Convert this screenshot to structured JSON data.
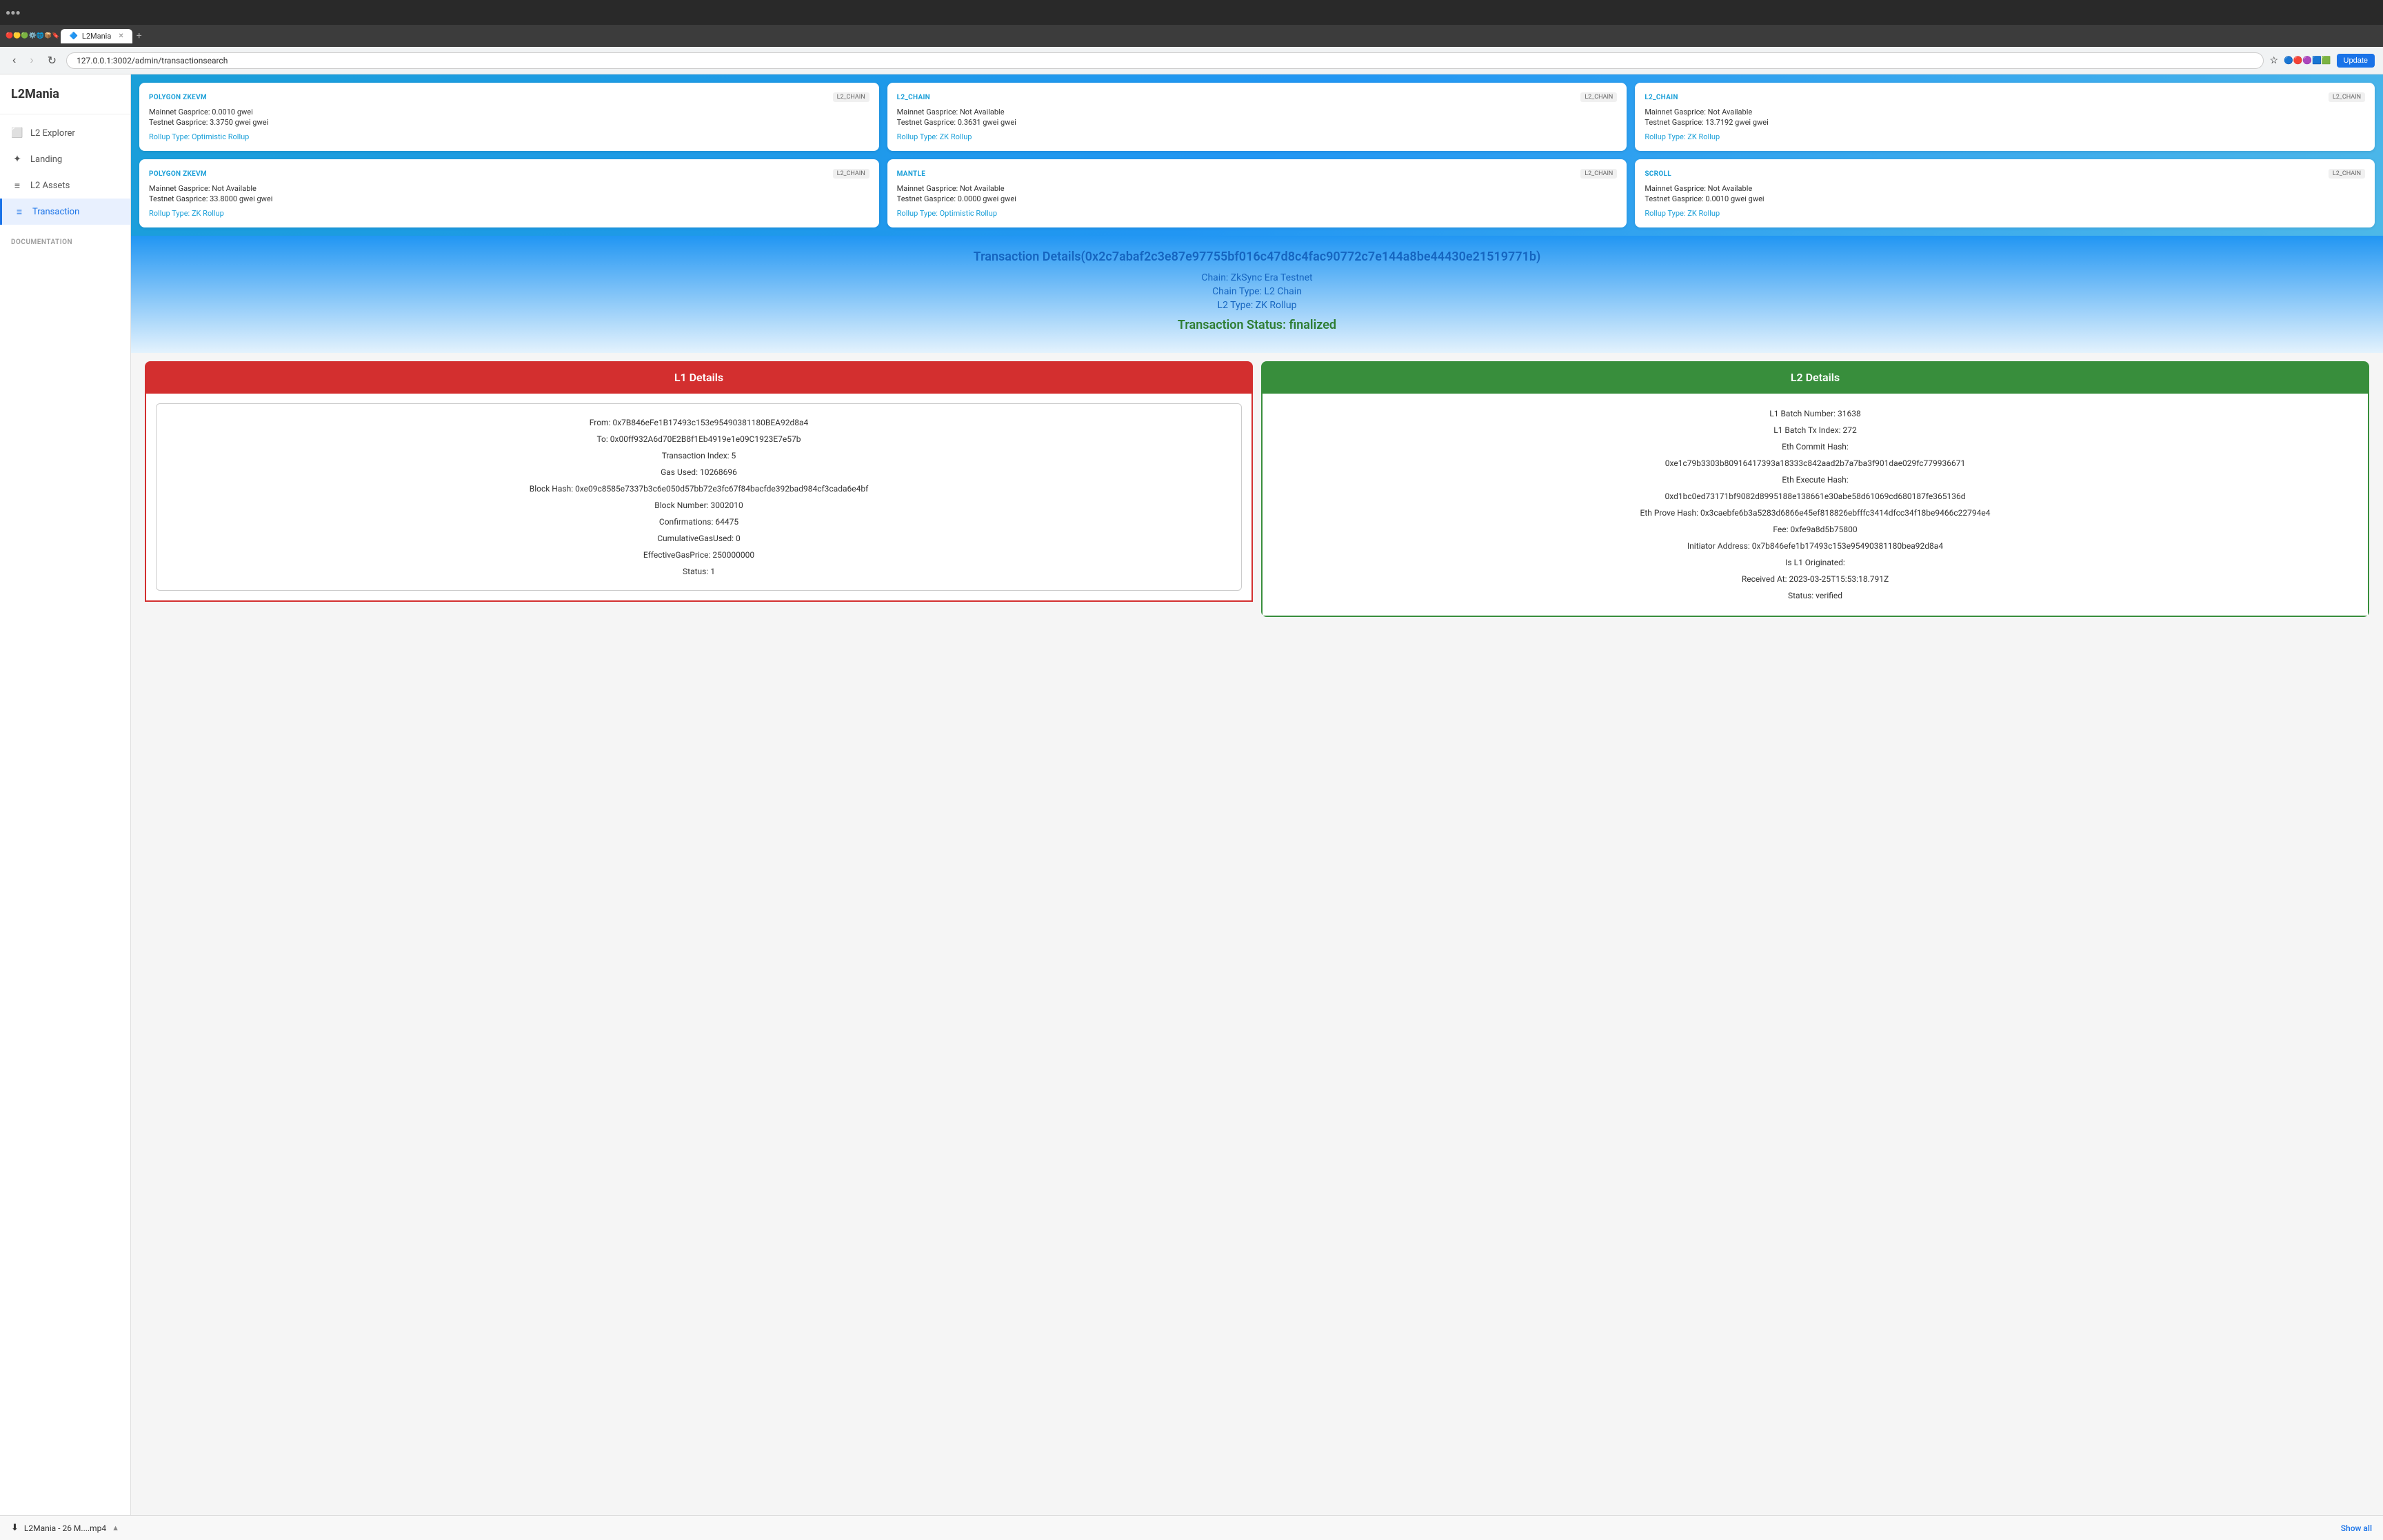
{
  "browser": {
    "url": "127.0.0.1:3002/admin/transactionsearch",
    "tab_title": "L2Mania",
    "update_btn": "Update"
  },
  "sidebar": {
    "logo": "L2Mania",
    "items": [
      {
        "id": "l2-explorer",
        "label": "L2 Explorer",
        "icon": "⬜"
      },
      {
        "id": "landing",
        "label": "Landing",
        "icon": "✦"
      },
      {
        "id": "l2-assets",
        "label": "L2 Assets",
        "icon": "≡"
      },
      {
        "id": "transaction",
        "label": "Transaction",
        "icon": "≡",
        "active": true
      }
    ],
    "section_documentation": "DOCUMENTATION"
  },
  "chain_cards": [
    {
      "name": "POLYGON ZKEVM",
      "badge": "L2_CHAIN",
      "mainnet_gasprice": "Mainnet Gasprice: 0.0010 gwei",
      "testnet_gasprice": "Testnet Gasprice: 3.3750 gwei gwei",
      "rollup_type": "Rollup Type: Optimistic Rollup"
    },
    {
      "name": "L2_CHAIN",
      "badge": "L2_CHAIN",
      "mainnet_gasprice": "Mainnet Gasprice: Not Available",
      "testnet_gasprice": "Testnet Gasprice: 0.3631 gwei gwei",
      "rollup_type": "Rollup Type: ZK Rollup"
    },
    {
      "name": "L2_CHAIN",
      "badge": "L2_CHAIN",
      "mainnet_gasprice": "Mainnet Gasprice: Not Available",
      "testnet_gasprice": "Testnet Gasprice: 13.7192 gwei gwei",
      "rollup_type": "Rollup Type: ZK Rollup"
    },
    {
      "name": "POLYGON ZKEVM",
      "badge": "L2_CHAIN",
      "mainnet_gasprice": "Mainnet Gasprice: Not Available",
      "testnet_gasprice": "Testnet Gasprice: 33.8000 gwei gwei",
      "rollup_type": "Rollup Type: ZK Rollup"
    },
    {
      "name": "MANTLE",
      "badge": "L2_CHAIN",
      "mainnet_gasprice": "Mainnet Gasprice: Not Available",
      "testnet_gasprice": "Testnet Gasprice: 0.0000 gwei gwei",
      "rollup_type": "Rollup Type: Optimistic Rollup"
    },
    {
      "name": "SCROLL",
      "badge": "L2_CHAIN",
      "mainnet_gasprice": "Mainnet Gasprice: Not Available",
      "testnet_gasprice": "Testnet Gasprice: 0.0010 gwei gwei",
      "rollup_type": "Rollup Type: ZK Rollup"
    }
  ],
  "transaction": {
    "title": "Transaction Details(0x2c7abaf2c3e87e97755bf016c47d8c4fac90772c7e144a8be44430e21519771b)",
    "chain": "Chain: ZkSync Era Testnet",
    "chain_type": "Chain Type: L2 Chain",
    "l2_type": "L2 Type: ZK Rollup",
    "status": "Transaction Status: finalized"
  },
  "l1_details": {
    "header": "L1 Details",
    "from": "From: 0x7B846eFe1B17493c153e95490381180BEA92d8a4",
    "to": "To: 0x00ff932A6d70E2B8f1Eb4919e1e09C1923E7e57b",
    "transaction_index": "Transaction Index: 5",
    "gas_used": "Gas Used: 10268696",
    "block_hash": "Block Hash: 0xe09c8585e7337b3c6e050d57bb72e3fc67f84bacfde392bad984cf3cada6e4bf",
    "block_number": "Block Number: 3002010",
    "confirmations": "Confirmations: 64475",
    "cumulative_gas": "CumulativeGasUsed: 0",
    "effective_gas": "EffectiveGasPrice: 250000000",
    "status": "Status: 1"
  },
  "l2_details": {
    "header": "L2 Details",
    "l1_batch_number": "L1 Batch Number: 31638",
    "l1_batch_tx_index": "L1 Batch Tx Index: 272",
    "eth_commit_hash_label": "Eth Commit Hash:",
    "eth_commit_hash": "0xe1c79b3303b80916417393a18333c842aad2b7a7ba3f901dae029fc779936671",
    "eth_execute_hash_label": "Eth Execute Hash:",
    "eth_execute_hash": "0xd1bc0ed73171bf9082d8995188e138661e30abe58d61069cd680187fe365136d",
    "eth_prove_hash": "Eth Prove Hash: 0x3caebfe6b3a5283d6866e45ef818826ebfffc3414dfcc34f18be9466c22794e4",
    "fee": "Fee: 0xfe9a8d5b75800",
    "initiator_address": "Initiator Address: 0x7b846efe1b17493c153e95490381180bea92d8a4",
    "is_l1_originated": "Is L1 Originated:",
    "received_at": "Received At: 2023-03-25T15:53:18.791Z",
    "status": "Status: verified"
  },
  "bottom_bar": {
    "download_label": "L2Mania - 26 M....mp4",
    "show_all": "Show all"
  }
}
